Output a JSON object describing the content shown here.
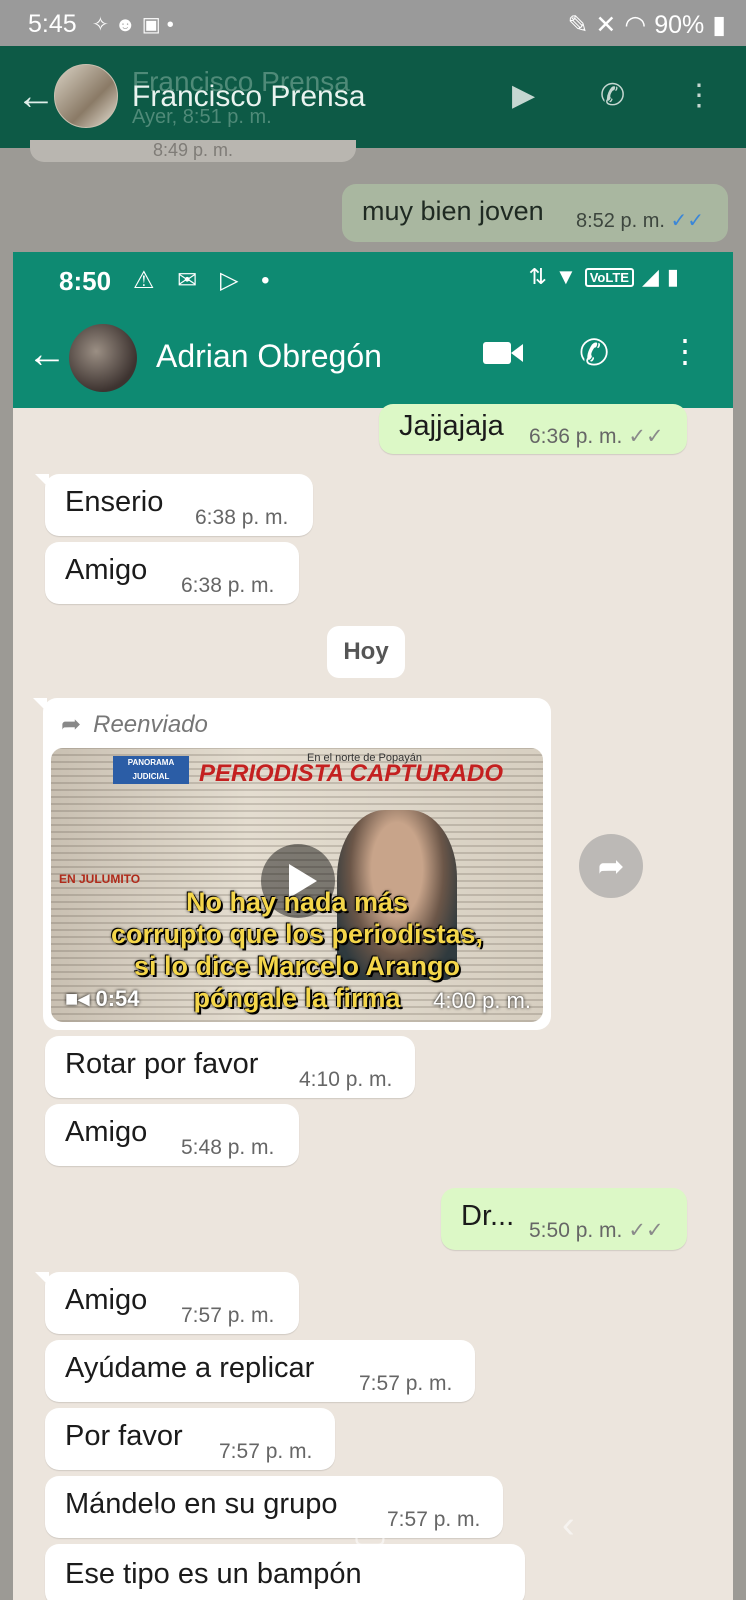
{
  "outer": {
    "status": {
      "time": "5:45",
      "battery": "90%"
    },
    "header": {
      "contact_name": "Francisco Prensa",
      "last_seen": "Ayer, 8:51 p. m."
    },
    "previous_time_fragment": "8:49 p. m.",
    "sent_message": {
      "text": "muy bien joven",
      "time": "8:52 p. m.",
      "ticks": "✓✓"
    }
  },
  "inner": {
    "status": {
      "time": "8:50",
      "volte": "VoLTE"
    },
    "header": {
      "contact_name": "Adrian Obregón"
    },
    "messages": [
      {
        "text": "Jajjajaja",
        "time": "6:36 p. m.",
        "ticks": "✓✓"
      },
      {
        "text": "Enserio",
        "time": "6:38 p. m."
      },
      {
        "text": "Amigo",
        "time": "6:38 p. m."
      },
      {
        "text": "Rotar por favor",
        "time": "4:10 p. m."
      },
      {
        "text": "Amigo",
        "time": "5:48 p. m."
      },
      {
        "text": "Dr...",
        "time": "5:50 p. m.",
        "ticks": "✓✓"
      },
      {
        "text": "Amigo",
        "time": "7:57 p. m."
      },
      {
        "text": "Ayúdame a replicar",
        "time": "7:57 p. m."
      },
      {
        "text": "Por favor",
        "time": "7:57 p. m."
      },
      {
        "text": "Mándelo en su grupo",
        "time": "7:57 p. m."
      },
      {
        "text": "Ese tipo es un bampón"
      }
    ],
    "day_separator": "Hoy",
    "forwarded": {
      "label": "Reenviado",
      "video": {
        "duration": "0:54",
        "time": "4:00 p. m.",
        "newspaper_kicker": "En el norte de Popayán",
        "newspaper_title": "PERIODISTA CAPTURADO",
        "newspaper_section": "PANORAMA JUDICIAL",
        "newspaper_side": "EN JULUMITO",
        "caption_lines": [
          "No hay nada más",
          "corrupto que los periodistas,",
          "si lo dice Marcelo Arango",
          "póngale la firma"
        ]
      }
    }
  },
  "colors": {
    "inner_header": "#0e8a72",
    "outer_header": "#0d5a46",
    "outgoing_bubble": "#dcf8c6",
    "caption": "#f4d64a"
  }
}
